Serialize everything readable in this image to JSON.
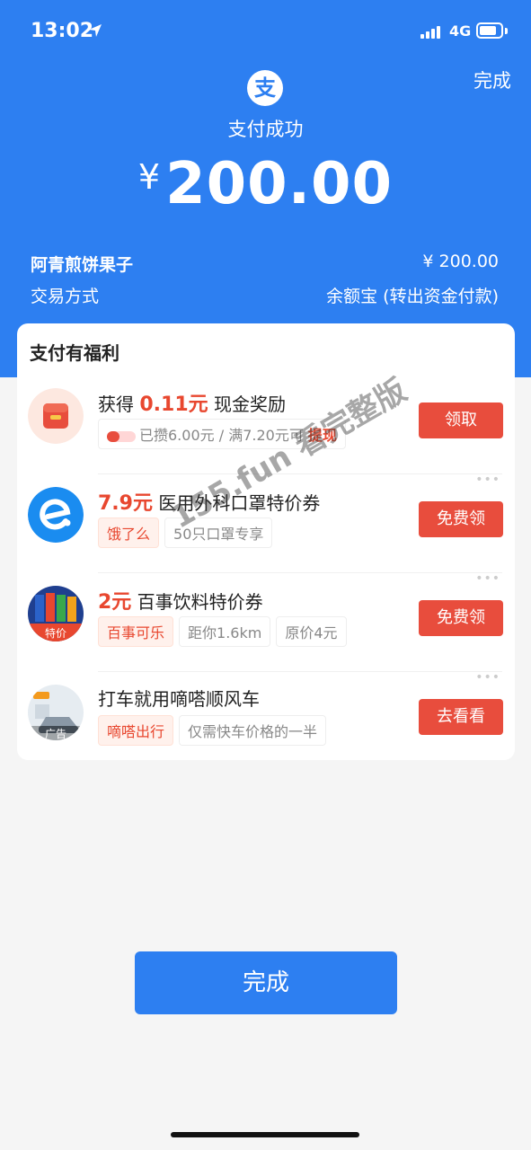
{
  "status": {
    "time": "13:02",
    "network": "4G"
  },
  "header": {
    "done_label": "完成",
    "logo_char": "支",
    "title": "支付成功",
    "currency": "¥",
    "amount": "200.00"
  },
  "details": {
    "merchant": "阿青煎饼果子",
    "merchant_amount": "¥ 200.00",
    "method_label": "交易方式",
    "method_value": "余额宝 (转出资金付款)"
  },
  "benefits": {
    "title": "支付有福利",
    "items": [
      {
        "title_prefix": "获得",
        "title_highlight": "0.11元",
        "title_rest": "现金奖励",
        "tag1": "已攒6.00元 / 满7.20元可",
        "tag1_link": "提现",
        "button": "领取"
      },
      {
        "title_highlight": "7.9元",
        "title_rest": "医用外科口罩特价券",
        "tag1": "饿了么",
        "tag2": "50只口罩专享",
        "button": "免费领"
      },
      {
        "title_highlight": "2元",
        "title_rest": "百事饮料特价券",
        "tag1": "百事可乐",
        "tag2": "距你1.6km",
        "tag3": "原价4元",
        "icon_label": "特价",
        "button": "免费领"
      },
      {
        "title_rest": "打车就用嘀嗒顺风车",
        "tag1": "嘀嗒出行",
        "tag2": "仅需快车价格的一半",
        "icon_label": "广告",
        "button": "去看看"
      }
    ]
  },
  "watermark": "155.fun 看完整版",
  "footer": {
    "done_label": "完成"
  },
  "colors": {
    "primary": "#2d7ff1",
    "accent": "#e84d3d"
  }
}
